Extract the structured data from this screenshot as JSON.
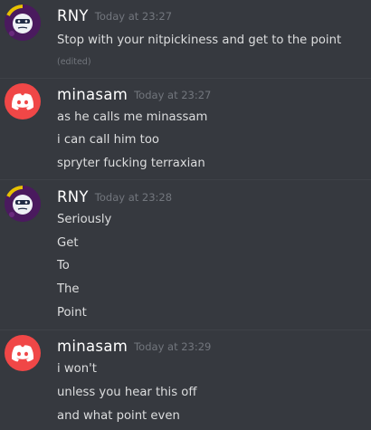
{
  "colors": {
    "background": "#36393f",
    "username": "#ffffff",
    "message_text": "#dcddde",
    "timestamp": "#72767d",
    "discord_avatar": "#f04747"
  },
  "groups": [
    {
      "author": "RNY",
      "avatar_icon": "rny-avatar-icon",
      "timestamp": "Today at 23:27",
      "lines": [
        "Stop with your nitpickiness and get to the point"
      ],
      "edited": "(edited)"
    },
    {
      "author": "minasam",
      "avatar_icon": "discord-logo-icon",
      "timestamp": "Today at 23:27",
      "lines": [
        "as he calls me minassam",
        "i can call him too",
        "spryter fucking terraxian"
      ]
    },
    {
      "author": "RNY",
      "avatar_icon": "rny-avatar-icon",
      "timestamp": "Today at 23:28",
      "lines": [
        "Seriously",
        "Get",
        "To",
        "The",
        "Point"
      ]
    },
    {
      "author": "minasam",
      "avatar_icon": "discord-logo-icon",
      "timestamp": "Today at 23:29",
      "lines": [
        "i won't",
        "unless you hear this off",
        "and what point even"
      ]
    }
  ]
}
